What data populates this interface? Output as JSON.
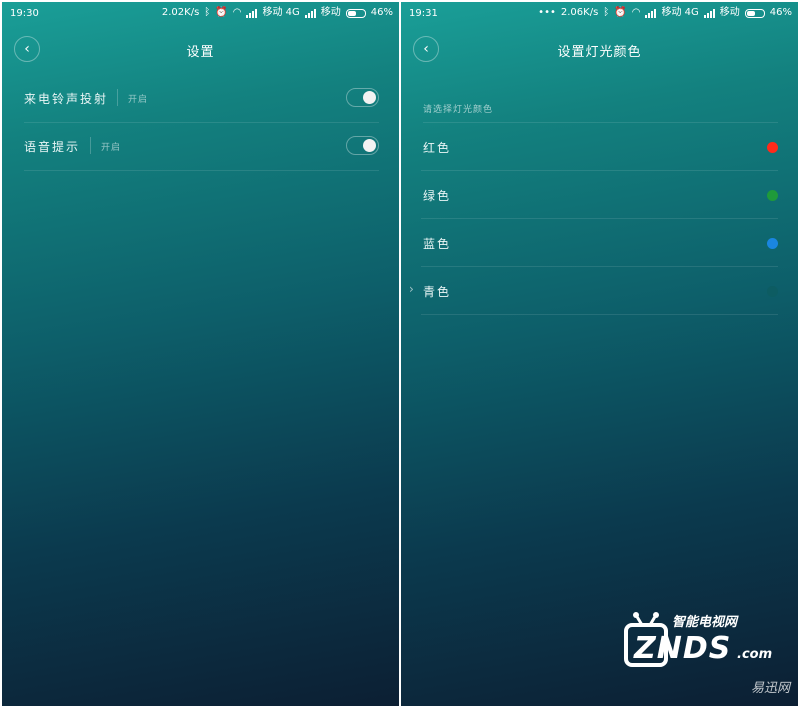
{
  "left": {
    "status": {
      "time": "19:30",
      "speed": "2.02K/s",
      "carrier1": "移动 4G",
      "carrier2": "移动",
      "battery": "46%"
    },
    "title": "设置",
    "rows": [
      {
        "label": "来电铃声投射",
        "value": "开启",
        "toggle_on": true
      },
      {
        "label": "语音提示",
        "value": "开启",
        "toggle_on": true
      }
    ]
  },
  "right": {
    "status": {
      "time": "19:31",
      "dots": "•••",
      "speed": "2.06K/s",
      "carrier1": "移动 4G",
      "carrier2": "移动",
      "battery": "46%"
    },
    "title": "设置灯光颜色",
    "hint": "请选择灯光颜色",
    "colors": [
      {
        "label": "红色",
        "color": "#ff2a1a"
      },
      {
        "label": "绿色",
        "color": "#1f9a3a"
      },
      {
        "label": "蓝色",
        "color": "#1a86e0"
      },
      {
        "label": "青色",
        "color": "#0d5c62"
      }
    ]
  },
  "watermark": {
    "cn": "智能电视网",
    "en": "ZNDS",
    "dot": ".com",
    "sub": "易迅网"
  },
  "icons": {
    "back": "chevron-left-icon",
    "bluetooth": "bluetooth-icon",
    "alarm": "alarm-clock-icon",
    "wifi": "wifi-icon",
    "signal": "signal-bars-icon",
    "battery": "battery-icon",
    "row_arrow": "chevron-right-icon"
  }
}
